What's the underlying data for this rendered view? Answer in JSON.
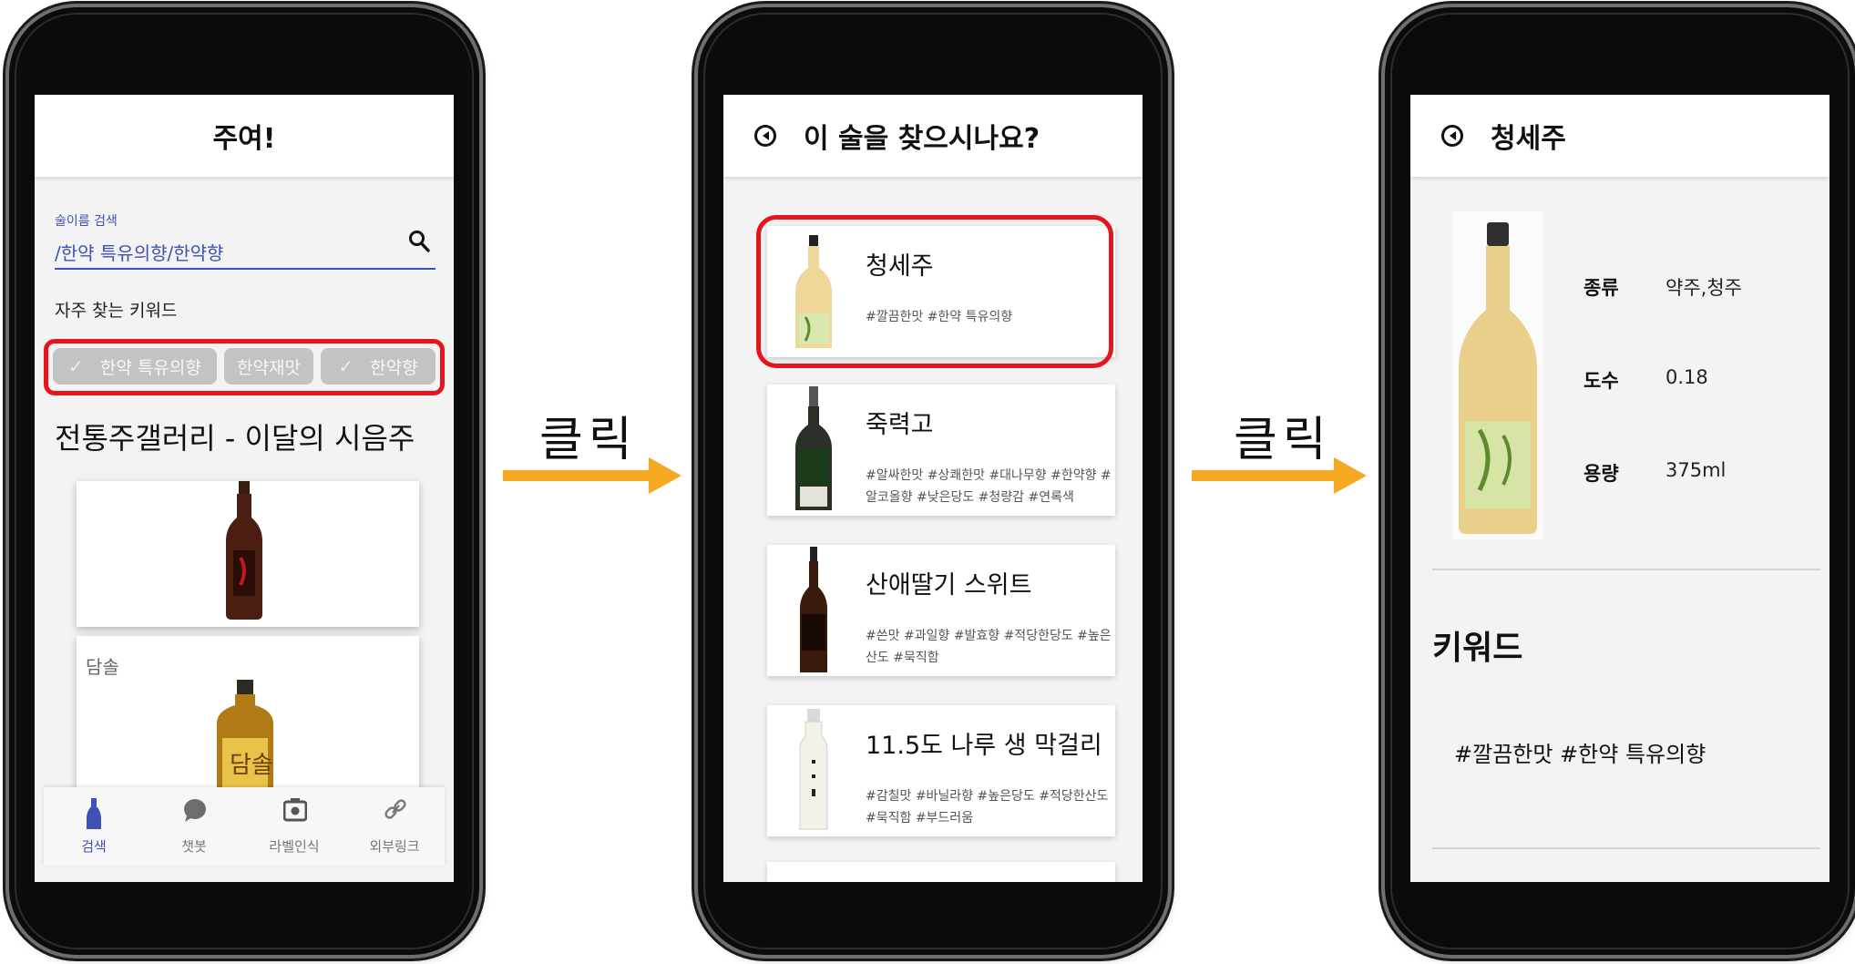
{
  "screen1": {
    "title": "주여!",
    "search_label": "술이름 검색",
    "search_value": "/한약 특유의향/한약향",
    "frequent_label": "자주 찾는 키워드",
    "chips": [
      "한약 특유의향",
      "한약재맛",
      "한약향"
    ],
    "gallery_title": "전통주갤러리 - 이달의 시음주",
    "card2_name": "담솔",
    "nav": [
      "검색",
      "챗봇",
      "라벨인식",
      "외부링크"
    ],
    "accent": "#3f51b5",
    "highlight": "#e8141b"
  },
  "arrows": {
    "label1": "클릭",
    "label2": "클릭",
    "color": "#f7a823"
  },
  "screen2": {
    "title": "이 술을 찾으시나요?",
    "results": [
      {
        "name": "청세주",
        "tags": "#깔끔한맛 #한약 특유의향"
      },
      {
        "name": "죽력고",
        "tags": "#알싸한맛 #상쾌한맛 #대나무향 #한약향 #알코올향 #낮은당도 #청량감 #연록색"
      },
      {
        "name": "산애딸기 스위트",
        "tags": "#쓴맛 #과일향 #발효향 #적당한당도 #높은산도 #묵직함"
      },
      {
        "name": "11.5도 나루 생 막걸리",
        "tags": "#감칠맛 #바닐라향 #높은당도 #적당한산도 #묵직함 #부드러움"
      }
    ]
  },
  "screen3": {
    "title": "청세주",
    "details": [
      {
        "key": "종류",
        "value": "약주,청주"
      },
      {
        "key": "도수",
        "value": "0.18"
      },
      {
        "key": "용량",
        "value": "375ml"
      }
    ],
    "keyword_title": "키워드",
    "keywords": "#깔끔한맛 #한약 특유의향"
  }
}
